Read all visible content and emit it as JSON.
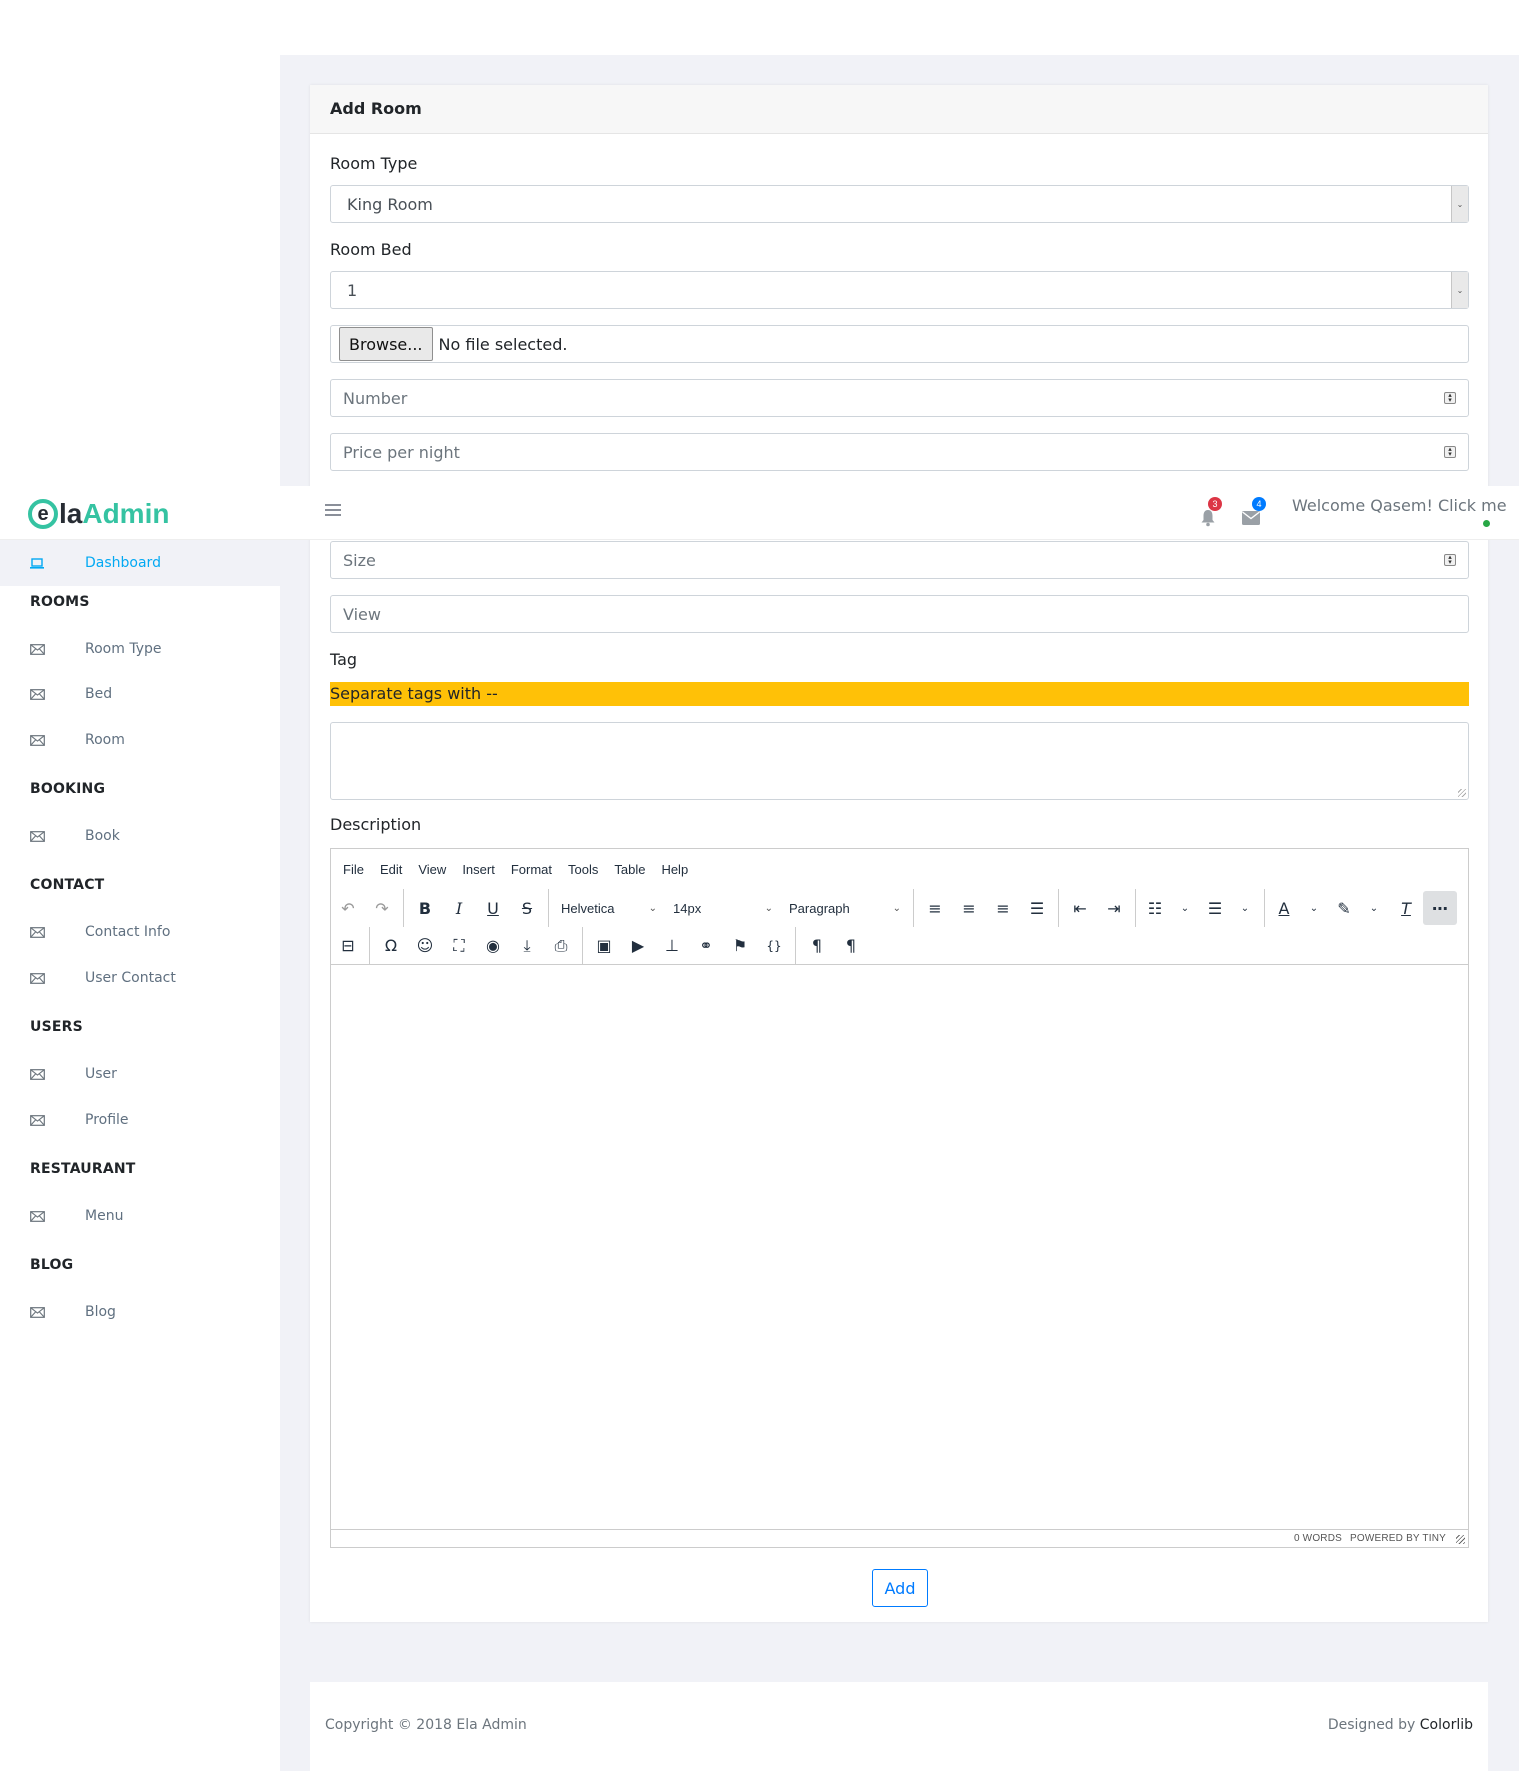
{
  "app": {
    "logo_prefix": "la",
    "logo_suffix": "Admin",
    "logo_letter": "e"
  },
  "topbar": {
    "notifications_count": "3",
    "messages_count": "4",
    "welcome": "Welcome Qasem! Click me",
    "colors": {
      "notif_badge": "#dc3545",
      "msg_badge": "#007bff",
      "online": "#28a745"
    }
  },
  "sidebar": {
    "dashboard": "Dashboard",
    "sections": [
      {
        "title": "ROOMS",
        "items": [
          "Room Type",
          "Bed",
          "Room"
        ]
      },
      {
        "title": "BOOKING",
        "items": [
          "Book"
        ]
      },
      {
        "title": "CONTACT",
        "items": [
          "Contact Info",
          "User Contact"
        ]
      },
      {
        "title": "USERS",
        "items": [
          "User",
          "Profile"
        ]
      },
      {
        "title": "RESTAURANT",
        "items": [
          "Menu"
        ]
      },
      {
        "title": "BLOG",
        "items": [
          "Blog"
        ]
      }
    ],
    "item_icon": "envelope-icon",
    "dashboard_icon": "laptop-icon"
  },
  "form": {
    "title": "Add Room",
    "room_type_label": "Room Type",
    "room_type_value": "King Room",
    "room_bed_label": "Room Bed",
    "room_bed_value": "1",
    "browse_label": "Browse...",
    "file_status": "No file selected.",
    "number_placeholder": "Number",
    "price_placeholder": "Price per night",
    "size_placeholder": "Size",
    "view_placeholder": "View",
    "tag_label": "Tag",
    "tag_note": "Separate tags with --",
    "description_label": "Description",
    "submit_label": "Add"
  },
  "editor": {
    "menu": [
      "File",
      "Edit",
      "View",
      "Insert",
      "Format",
      "Tools",
      "Table",
      "Help"
    ],
    "font_family": "Helvetica",
    "font_size": "14px",
    "block_format": "Paragraph",
    "status_words": "0 WORDS",
    "status_powered": "POWERED BY TINY"
  },
  "footer": {
    "copyright": "Copyright © 2018 Ela Admin",
    "designed_by": "Designed by",
    "designer": "Colorlib"
  }
}
